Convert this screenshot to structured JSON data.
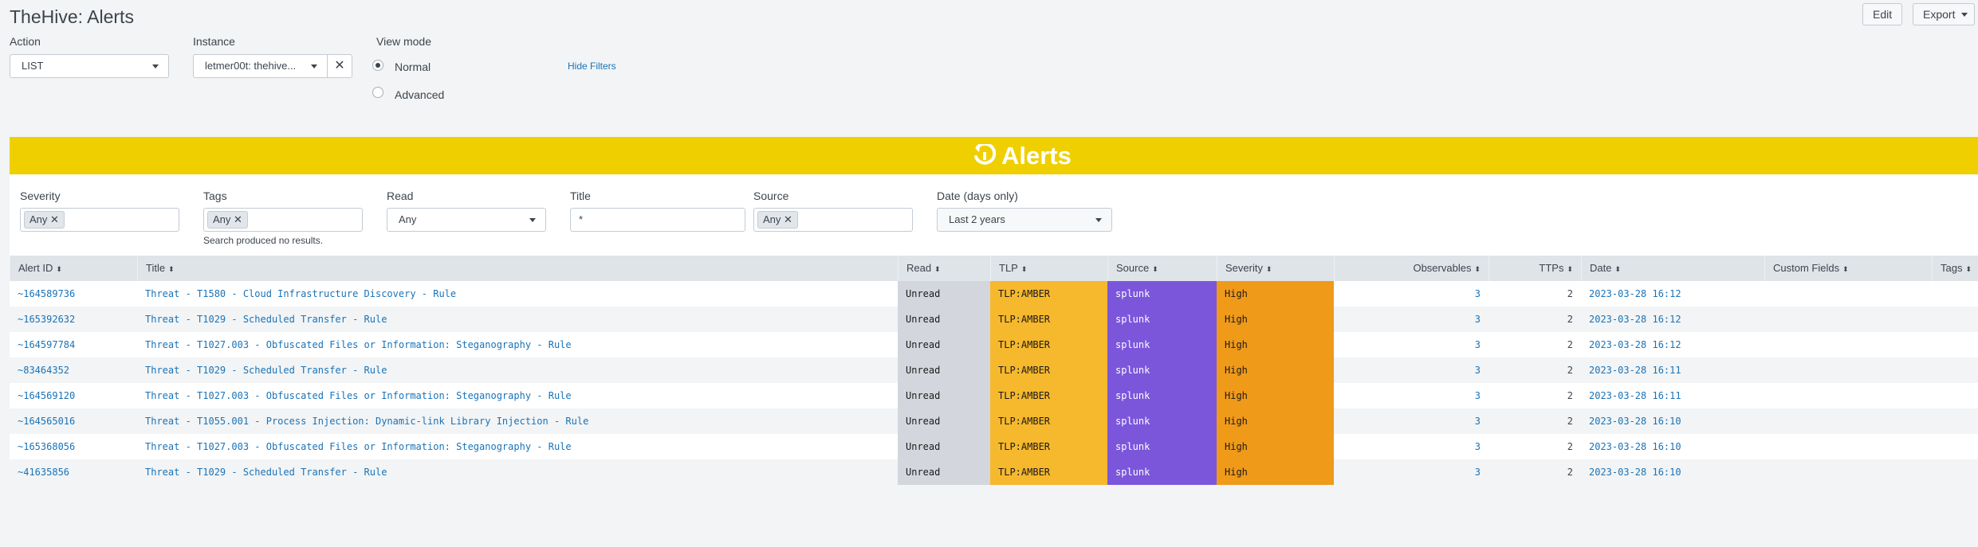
{
  "page": {
    "title": "TheHive: Alerts"
  },
  "toolbar": {
    "edit_label": "Edit",
    "export_label": "Export"
  },
  "controls": {
    "action": {
      "label": "Action",
      "value": "LIST"
    },
    "instance": {
      "label": "Instance",
      "value": "letmer00t: thehive..."
    },
    "view_mode": {
      "label": "View mode",
      "options": [
        "Normal",
        "Advanced"
      ],
      "selected": "Normal"
    },
    "hide_filters": "Hide Filters"
  },
  "banner": {
    "title": "Alerts",
    "icon": "thehive-logo-icon"
  },
  "filters": {
    "severity": {
      "label": "Severity",
      "tag": "Any"
    },
    "tags": {
      "label": "Tags",
      "tag": "Any",
      "note": "Search produced no results."
    },
    "read": {
      "label": "Read",
      "value": "Any"
    },
    "title": {
      "label": "Title",
      "value": "*"
    },
    "source": {
      "label": "Source",
      "tag": "Any"
    },
    "date": {
      "label": "Date (days only)",
      "value": "Last 2 years"
    }
  },
  "table": {
    "columns": [
      "Alert ID",
      "Title",
      "Read",
      "TLP",
      "Source",
      "Severity",
      "Observables",
      "TTPs",
      "Date",
      "Custom Fields",
      "Tags"
    ],
    "rows": [
      {
        "id": "~164589736",
        "title": "Threat - T1580 - Cloud Infrastructure Discovery - Rule",
        "read": "Unread",
        "tlp": "TLP:AMBER",
        "source": "splunk",
        "severity": "High",
        "observables": "3",
        "ttps": "2",
        "date": "2023-03-28 16:12"
      },
      {
        "id": "~165392632",
        "title": "Threat - T1029 - Scheduled Transfer - Rule",
        "read": "Unread",
        "tlp": "TLP:AMBER",
        "source": "splunk",
        "severity": "High",
        "observables": "3",
        "ttps": "2",
        "date": "2023-03-28 16:12"
      },
      {
        "id": "~164597784",
        "title": "Threat - T1027.003 - Obfuscated Files or Information: Steganography - Rule",
        "read": "Unread",
        "tlp": "TLP:AMBER",
        "source": "splunk",
        "severity": "High",
        "observables": "3",
        "ttps": "2",
        "date": "2023-03-28 16:12"
      },
      {
        "id": "~83464352",
        "title": "Threat - T1029 - Scheduled Transfer - Rule",
        "read": "Unread",
        "tlp": "TLP:AMBER",
        "source": "splunk",
        "severity": "High",
        "observables": "3",
        "ttps": "2",
        "date": "2023-03-28 16:11"
      },
      {
        "id": "~164569120",
        "title": "Threat - T1027.003 - Obfuscated Files or Information: Steganography - Rule",
        "read": "Unread",
        "tlp": "TLP:AMBER",
        "source": "splunk",
        "severity": "High",
        "observables": "3",
        "ttps": "2",
        "date": "2023-03-28 16:11"
      },
      {
        "id": "~164565016",
        "title": "Threat - T1055.001 - Process Injection: Dynamic-link Library Injection - Rule",
        "read": "Unread",
        "tlp": "TLP:AMBER",
        "source": "splunk",
        "severity": "High",
        "observables": "3",
        "ttps": "2",
        "date": "2023-03-28 16:10"
      },
      {
        "id": "~165368056",
        "title": "Threat - T1027.003 - Obfuscated Files or Information: Steganography - Rule",
        "read": "Unread",
        "tlp": "TLP:AMBER",
        "source": "splunk",
        "severity": "High",
        "observables": "3",
        "ttps": "2",
        "date": "2023-03-28 16:10"
      },
      {
        "id": "~41635856",
        "title": "Threat - T1029 - Scheduled Transfer - Rule",
        "read": "Unread",
        "tlp": "TLP:AMBER",
        "source": "splunk",
        "severity": "High",
        "observables": "3",
        "ttps": "2",
        "date": "2023-03-28 16:10"
      }
    ]
  },
  "colors": {
    "banner": "#f0cf00",
    "read": "#d3d7dd",
    "tlp_amber": "#f6b82d",
    "source": "#7b56db",
    "severity_high": "#f09a1a",
    "link": "#1a73b8"
  }
}
